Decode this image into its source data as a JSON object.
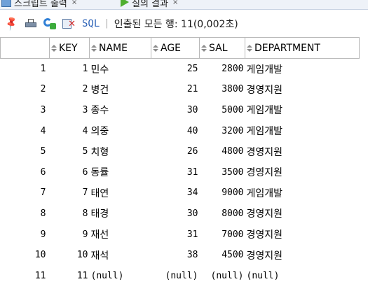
{
  "tabs": [
    {
      "label": "스크립트 출력",
      "close": "×"
    },
    {
      "label": "질의 결과",
      "close": "×"
    }
  ],
  "toolbar": {
    "sql_label": "SQL",
    "separator": "|",
    "status": "인출된 모든 행: 11(0,002초)"
  },
  "grid": {
    "columns": [
      "KEY",
      "NAME",
      "AGE",
      "SAL",
      "DEPARTMENT"
    ],
    "rows": [
      [
        "1",
        "1",
        "민수",
        "25",
        "2800",
        "게임개발"
      ],
      [
        "2",
        "2",
        "병건",
        "21",
        "3800",
        "경영지원"
      ],
      [
        "3",
        "3",
        "종수",
        "30",
        "5000",
        "게임개발"
      ],
      [
        "4",
        "4",
        "의중",
        "40",
        "3200",
        "게임개발"
      ],
      [
        "5",
        "5",
        "치형",
        "26",
        "4800",
        "경영지원"
      ],
      [
        "6",
        "6",
        "동률",
        "31",
        "3500",
        "경영지원"
      ],
      [
        "7",
        "7",
        "태연",
        "34",
        "9000",
        "게임개발"
      ],
      [
        "8",
        "8",
        "태경",
        "30",
        "8000",
        "경영지원"
      ],
      [
        "9",
        "9",
        "재선",
        "31",
        "7000",
        "경영지원"
      ],
      [
        "10",
        "10",
        "재석",
        "38",
        "4500",
        "경영지원"
      ],
      [
        "11",
        "11",
        "(null)",
        "(null)",
        "(null)",
        "(null)"
      ]
    ]
  }
}
